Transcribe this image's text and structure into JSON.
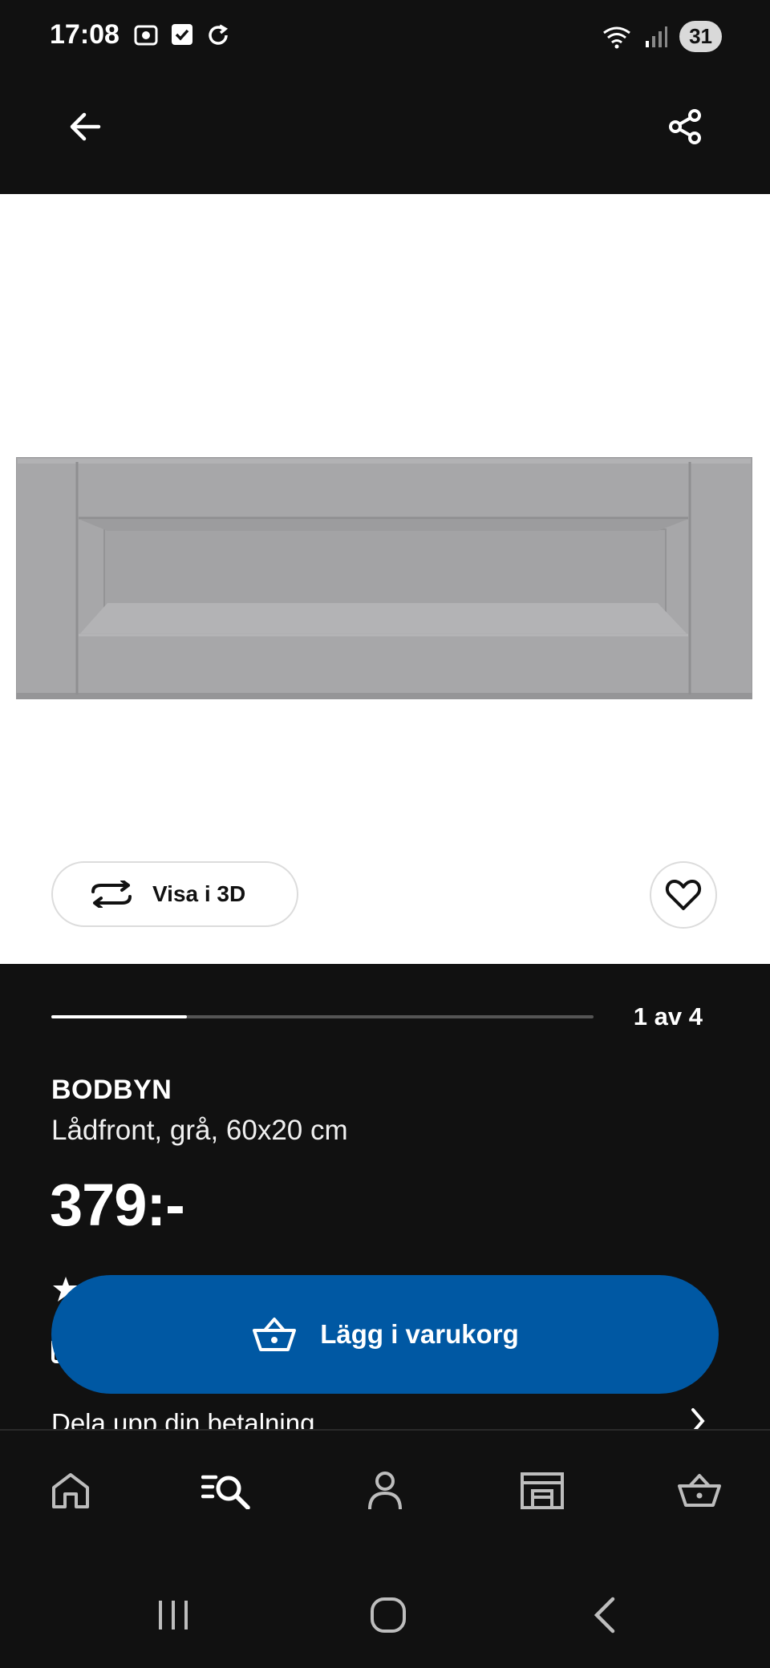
{
  "status_bar": {
    "time": "17:08",
    "battery": "31"
  },
  "app_bar": {
    "back_icon": "arrow-left-icon",
    "share_icon": "share-icon"
  },
  "gallery": {
    "view_3d_label": "Visa i 3D",
    "pager_text": "1 av 4",
    "progress_fraction": 0.25
  },
  "product": {
    "name": "BODBYN",
    "description": "Lådfront, grå, 60x20 cm",
    "price": "379:-"
  },
  "actions": {
    "add_to_cart_label": "Lägg i varukorg"
  },
  "installment": {
    "label": "Dela upp din betalning"
  },
  "bottom_nav": {
    "items": [
      {
        "icon": "home-icon"
      },
      {
        "icon": "search-list-icon",
        "active": true
      },
      {
        "icon": "profile-icon"
      },
      {
        "icon": "store-icon"
      },
      {
        "icon": "cart-icon"
      }
    ]
  },
  "colors": {
    "background": "#111111",
    "primary_button": "#0058a3",
    "product_gray": "#a7a7a9"
  }
}
